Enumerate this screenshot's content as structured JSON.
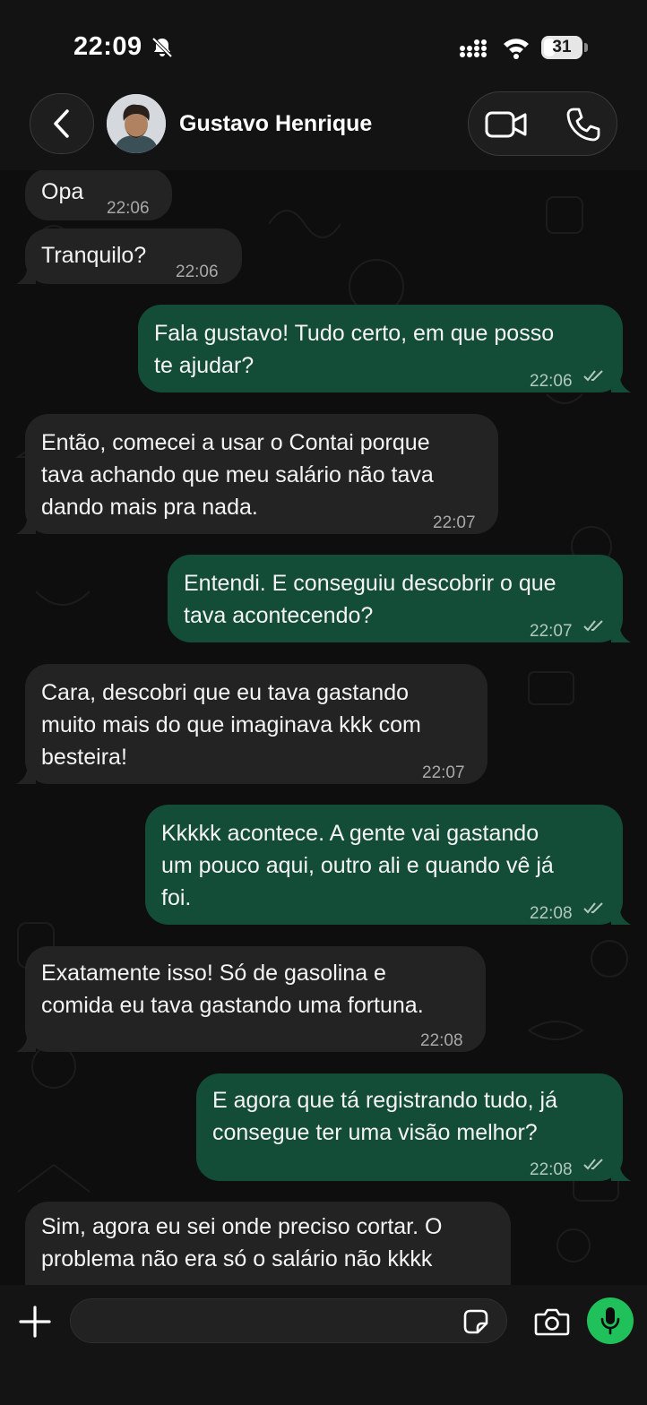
{
  "status_bar": {
    "time": "22:09",
    "battery_level": "31",
    "battery_fraction": 0.31
  },
  "header": {
    "contact_name": "Gustavo Henrique",
    "back_icon": "chevron-left-icon",
    "video_icon": "video-camera-icon",
    "phone_icon": "phone-icon"
  },
  "colors": {
    "incoming_bubble": "#232323",
    "outgoing_bubble": "#144d37",
    "accent": "#20c05a"
  },
  "messages": [
    {
      "direction": "in",
      "text": "Opa",
      "time": "22:06"
    },
    {
      "direction": "in",
      "text": "Tranquilo?",
      "time": "22:06"
    },
    {
      "direction": "out",
      "text": "Fala gustavo! Tudo certo, em que posso\nte ajudar?",
      "time": "22:06",
      "read": true
    },
    {
      "direction": "in",
      "text": "Então, comecei a usar o Contai porque\ntava achando que meu salário não tava\ndando mais pra nada.",
      "time": "22:07"
    },
    {
      "direction": "out",
      "text": "Entendi. E conseguiu descobrir o que\ntava acontecendo?",
      "time": "22:07",
      "read": true
    },
    {
      "direction": "in",
      "text": "Cara, descobri que eu tava gastando\nmuito mais do que imaginava kkk com\nbesteira!",
      "time": "22:07"
    },
    {
      "direction": "out",
      "text": "Kkkkk acontece. A gente vai gastando\num pouco aqui, outro ali e quando vê já\nfoi.",
      "time": "22:08",
      "read": true
    },
    {
      "direction": "in",
      "text": "Exatamente isso! Só de gasolina e\ncomida eu tava gastando uma fortuna.",
      "time": "22:08"
    },
    {
      "direction": "out",
      "text": "E agora que tá registrando tudo, já\nconsegue ter uma visão melhor?",
      "time": "22:08",
      "read": true
    },
    {
      "direction": "in",
      "text": "Sim, agora eu sei onde preciso cortar. O\nproblema não era só o salário não kkkk",
      "time": ""
    }
  ],
  "composer": {
    "placeholder": "",
    "plus_icon": "plus-icon",
    "sticker_icon": "sticker-icon",
    "camera_icon": "camera-icon",
    "mic_icon": "microphone-icon"
  }
}
